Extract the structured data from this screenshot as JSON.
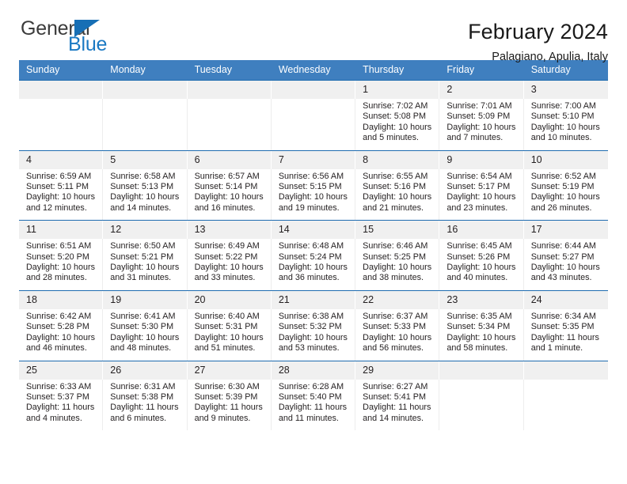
{
  "brand": {
    "name_top": "General",
    "name_bottom": "Blue",
    "triangle_icon": "blue-triangle-logo-mark",
    "accent_color": "#1b79c3"
  },
  "header": {
    "title": "February 2024",
    "subtitle": "Palagiano, Apulia, Italy"
  },
  "calendar": {
    "header_bg": "#3f7fbf",
    "row_band_bg": "#f0f0f0",
    "row_border": "#1f6cb0",
    "weekdays": [
      "Sunday",
      "Monday",
      "Tuesday",
      "Wednesday",
      "Thursday",
      "Friday",
      "Saturday"
    ],
    "weeks": [
      [
        {
          "day": "",
          "lines": []
        },
        {
          "day": "",
          "lines": []
        },
        {
          "day": "",
          "lines": []
        },
        {
          "day": "",
          "lines": []
        },
        {
          "day": "1",
          "lines": [
            "Sunrise: 7:02 AM",
            "Sunset: 5:08 PM",
            "Daylight: 10 hours",
            "and 5 minutes."
          ]
        },
        {
          "day": "2",
          "lines": [
            "Sunrise: 7:01 AM",
            "Sunset: 5:09 PM",
            "Daylight: 10 hours",
            "and 7 minutes."
          ]
        },
        {
          "day": "3",
          "lines": [
            "Sunrise: 7:00 AM",
            "Sunset: 5:10 PM",
            "Daylight: 10 hours",
            "and 10 minutes."
          ]
        }
      ],
      [
        {
          "day": "4",
          "lines": [
            "Sunrise: 6:59 AM",
            "Sunset: 5:11 PM",
            "Daylight: 10 hours",
            "and 12 minutes."
          ]
        },
        {
          "day": "5",
          "lines": [
            "Sunrise: 6:58 AM",
            "Sunset: 5:13 PM",
            "Daylight: 10 hours",
            "and 14 minutes."
          ]
        },
        {
          "day": "6",
          "lines": [
            "Sunrise: 6:57 AM",
            "Sunset: 5:14 PM",
            "Daylight: 10 hours",
            "and 16 minutes."
          ]
        },
        {
          "day": "7",
          "lines": [
            "Sunrise: 6:56 AM",
            "Sunset: 5:15 PM",
            "Daylight: 10 hours",
            "and 19 minutes."
          ]
        },
        {
          "day": "8",
          "lines": [
            "Sunrise: 6:55 AM",
            "Sunset: 5:16 PM",
            "Daylight: 10 hours",
            "and 21 minutes."
          ]
        },
        {
          "day": "9",
          "lines": [
            "Sunrise: 6:54 AM",
            "Sunset: 5:17 PM",
            "Daylight: 10 hours",
            "and 23 minutes."
          ]
        },
        {
          "day": "10",
          "lines": [
            "Sunrise: 6:52 AM",
            "Sunset: 5:19 PM",
            "Daylight: 10 hours",
            "and 26 minutes."
          ]
        }
      ],
      [
        {
          "day": "11",
          "lines": [
            "Sunrise: 6:51 AM",
            "Sunset: 5:20 PM",
            "Daylight: 10 hours",
            "and 28 minutes."
          ]
        },
        {
          "day": "12",
          "lines": [
            "Sunrise: 6:50 AM",
            "Sunset: 5:21 PM",
            "Daylight: 10 hours",
            "and 31 minutes."
          ]
        },
        {
          "day": "13",
          "lines": [
            "Sunrise: 6:49 AM",
            "Sunset: 5:22 PM",
            "Daylight: 10 hours",
            "and 33 minutes."
          ]
        },
        {
          "day": "14",
          "lines": [
            "Sunrise: 6:48 AM",
            "Sunset: 5:24 PM",
            "Daylight: 10 hours",
            "and 36 minutes."
          ]
        },
        {
          "day": "15",
          "lines": [
            "Sunrise: 6:46 AM",
            "Sunset: 5:25 PM",
            "Daylight: 10 hours",
            "and 38 minutes."
          ]
        },
        {
          "day": "16",
          "lines": [
            "Sunrise: 6:45 AM",
            "Sunset: 5:26 PM",
            "Daylight: 10 hours",
            "and 40 minutes."
          ]
        },
        {
          "day": "17",
          "lines": [
            "Sunrise: 6:44 AM",
            "Sunset: 5:27 PM",
            "Daylight: 10 hours",
            "and 43 minutes."
          ]
        }
      ],
      [
        {
          "day": "18",
          "lines": [
            "Sunrise: 6:42 AM",
            "Sunset: 5:28 PM",
            "Daylight: 10 hours",
            "and 46 minutes."
          ]
        },
        {
          "day": "19",
          "lines": [
            "Sunrise: 6:41 AM",
            "Sunset: 5:30 PM",
            "Daylight: 10 hours",
            "and 48 minutes."
          ]
        },
        {
          "day": "20",
          "lines": [
            "Sunrise: 6:40 AM",
            "Sunset: 5:31 PM",
            "Daylight: 10 hours",
            "and 51 minutes."
          ]
        },
        {
          "day": "21",
          "lines": [
            "Sunrise: 6:38 AM",
            "Sunset: 5:32 PM",
            "Daylight: 10 hours",
            "and 53 minutes."
          ]
        },
        {
          "day": "22",
          "lines": [
            "Sunrise: 6:37 AM",
            "Sunset: 5:33 PM",
            "Daylight: 10 hours",
            "and 56 minutes."
          ]
        },
        {
          "day": "23",
          "lines": [
            "Sunrise: 6:35 AM",
            "Sunset: 5:34 PM",
            "Daylight: 10 hours",
            "and 58 minutes."
          ]
        },
        {
          "day": "24",
          "lines": [
            "Sunrise: 6:34 AM",
            "Sunset: 5:35 PM",
            "Daylight: 11 hours",
            "and 1 minute."
          ]
        }
      ],
      [
        {
          "day": "25",
          "lines": [
            "Sunrise: 6:33 AM",
            "Sunset: 5:37 PM",
            "Daylight: 11 hours",
            "and 4 minutes."
          ]
        },
        {
          "day": "26",
          "lines": [
            "Sunrise: 6:31 AM",
            "Sunset: 5:38 PM",
            "Daylight: 11 hours",
            "and 6 minutes."
          ]
        },
        {
          "day": "27",
          "lines": [
            "Sunrise: 6:30 AM",
            "Sunset: 5:39 PM",
            "Daylight: 11 hours",
            "and 9 minutes."
          ]
        },
        {
          "day": "28",
          "lines": [
            "Sunrise: 6:28 AM",
            "Sunset: 5:40 PM",
            "Daylight: 11 hours",
            "and 11 minutes."
          ]
        },
        {
          "day": "29",
          "lines": [
            "Sunrise: 6:27 AM",
            "Sunset: 5:41 PM",
            "Daylight: 11 hours",
            "and 14 minutes."
          ]
        },
        {
          "day": "",
          "lines": []
        },
        {
          "day": "",
          "lines": []
        }
      ]
    ]
  }
}
